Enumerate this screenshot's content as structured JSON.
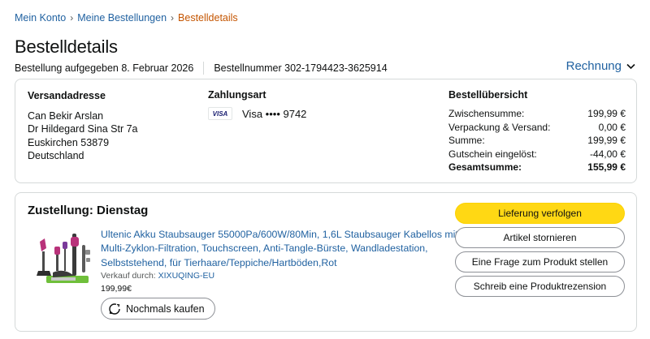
{
  "breadcrumb": {
    "items": [
      "Mein Konto",
      "Meine Bestellungen",
      "Bestelldetails"
    ],
    "separator": "›"
  },
  "page_title": "Bestelldetails",
  "order_meta": {
    "placed": "Bestellung aufgegeben 8. Februar 2026",
    "number": "Bestellnummer 302-1794423-3625914"
  },
  "invoice_label": "Rechnung",
  "shipping": {
    "title": "Versandadresse",
    "lines": [
      "Can Bekir Arslan",
      "Dr Hildegard Sina Str 7a",
      "Euskirchen 53879",
      "Deutschland"
    ]
  },
  "payment": {
    "title": "Zahlungsart",
    "card_badge": "VISA",
    "card_text": "Visa •••• 9742"
  },
  "overview": {
    "title": "Bestellübersicht",
    "rows": [
      {
        "label": "Zwischensumme:",
        "value": "199,99 €"
      },
      {
        "label": "Verpackung & Versand:",
        "value": "0,00 €"
      },
      {
        "label": "Summe:",
        "value": "199,99 €"
      },
      {
        "label": "Gutschein eingelöst:",
        "value": "-44,00 €"
      }
    ],
    "total": {
      "label": "Gesamtsumme:",
      "value": "155,99 €"
    }
  },
  "delivery": {
    "title": "Zustellung: Dienstag",
    "product_title": "Ultenic Akku Staubsauger 55000Pa/600W/80Min, 1,6L Staubsauger Kabellos mit Multi-Zyklon-Filtration, Touchscreen, Anti-Tangle-Bürste, Wandladestation, Selbststehend, für Tierhaare/Teppiche/Hartböden,Rot",
    "seller_prefix": "Verkauf durch:",
    "seller_name": "XIXUQING-EU",
    "price": "199,99€",
    "buy_again": "Nochmals kaufen"
  },
  "actions": {
    "track": "Lieferung verfolgen",
    "cancel": "Artikel stornieren",
    "question": "Eine Frage zum Produkt stellen",
    "review": "Schreib eine Produktrezension"
  },
  "colors": {
    "link": "#2162a1",
    "breadcrumb_current": "#c45500",
    "primary_button": "#ffd814",
    "border": "#d5d9d9",
    "product_accent": "#b8327a"
  },
  "icons": [
    "chevron-down-icon",
    "visa-card-icon",
    "reorder-icon",
    "product-image"
  ]
}
